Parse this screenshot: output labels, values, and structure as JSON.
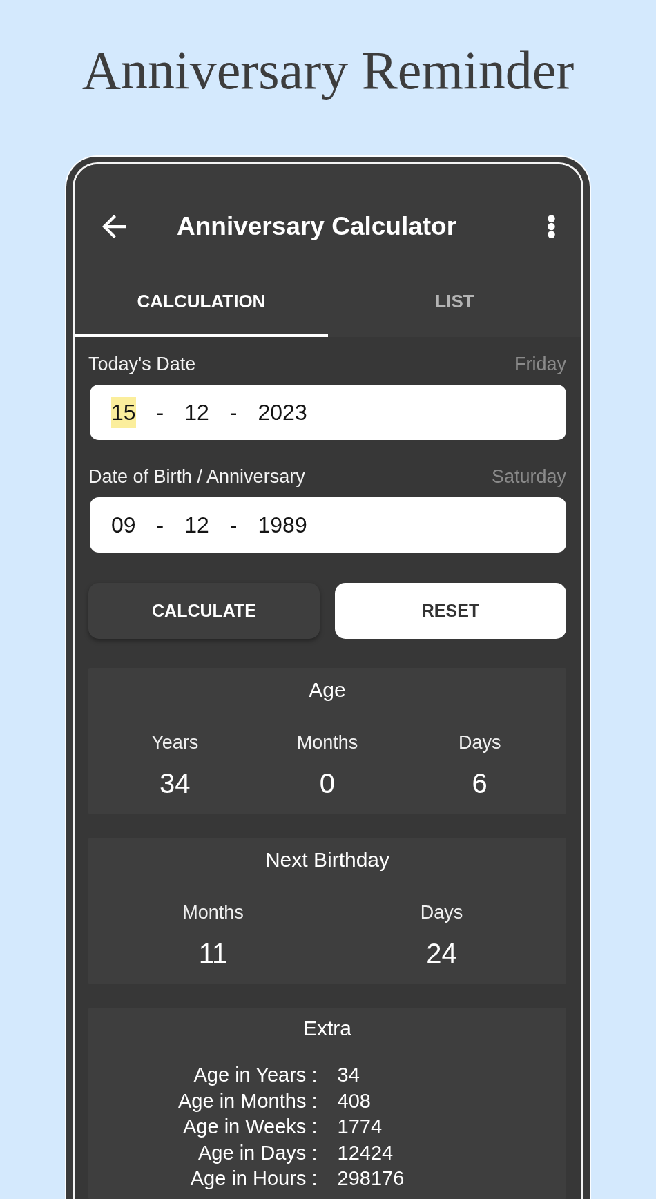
{
  "header": {
    "title": "Anniversary Reminder"
  },
  "app_bar": {
    "title": "Anniversary Calculator"
  },
  "tabs": [
    {
      "label": "CALCULATION",
      "selected": true
    },
    {
      "label": "LIST",
      "selected": false
    }
  ],
  "date_fields": [
    {
      "label": "Today's Date",
      "weekday": "Friday",
      "segments": [
        {
          "text": "15",
          "selected": true
        },
        {
          "text": "12",
          "selected": false
        },
        {
          "text": "2023",
          "selected": false
        }
      ],
      "separators": [
        "-",
        "-"
      ]
    },
    {
      "label": "Date of Birth / Anniversary",
      "weekday": "Saturday",
      "segments": [
        {
          "text": "09",
          "selected": false
        },
        {
          "text": "12",
          "selected": false
        },
        {
          "text": "1989",
          "selected": false
        }
      ],
      "separators": [
        "-",
        "-"
      ]
    }
  ],
  "buttons": [
    {
      "label": "CALCULATE",
      "kind": "raised"
    },
    {
      "label": "RESET",
      "kind": "flat"
    }
  ],
  "result_cards": [
    {
      "title": "Age",
      "columns": [
        {
          "label": "Years",
          "value": "34"
        },
        {
          "label": "Months",
          "value": "0"
        },
        {
          "label": "Days",
          "value": "6"
        }
      ]
    },
    {
      "title": "Next Birthday",
      "columns": [
        {
          "label": "Months",
          "value": "11"
        },
        {
          "label": "Days",
          "value": "24"
        }
      ]
    }
  ],
  "extra": {
    "title": "Extra",
    "rows": [
      {
        "label": "Age in Years :",
        "value": "34"
      },
      {
        "label": "Age in Months :",
        "value": "408"
      },
      {
        "label": "Age in Weeks :",
        "value": "1774"
      },
      {
        "label": "Age in Days :",
        "value": "12424"
      },
      {
        "label": "Age in Hours :",
        "value": "298176"
      }
    ]
  }
}
